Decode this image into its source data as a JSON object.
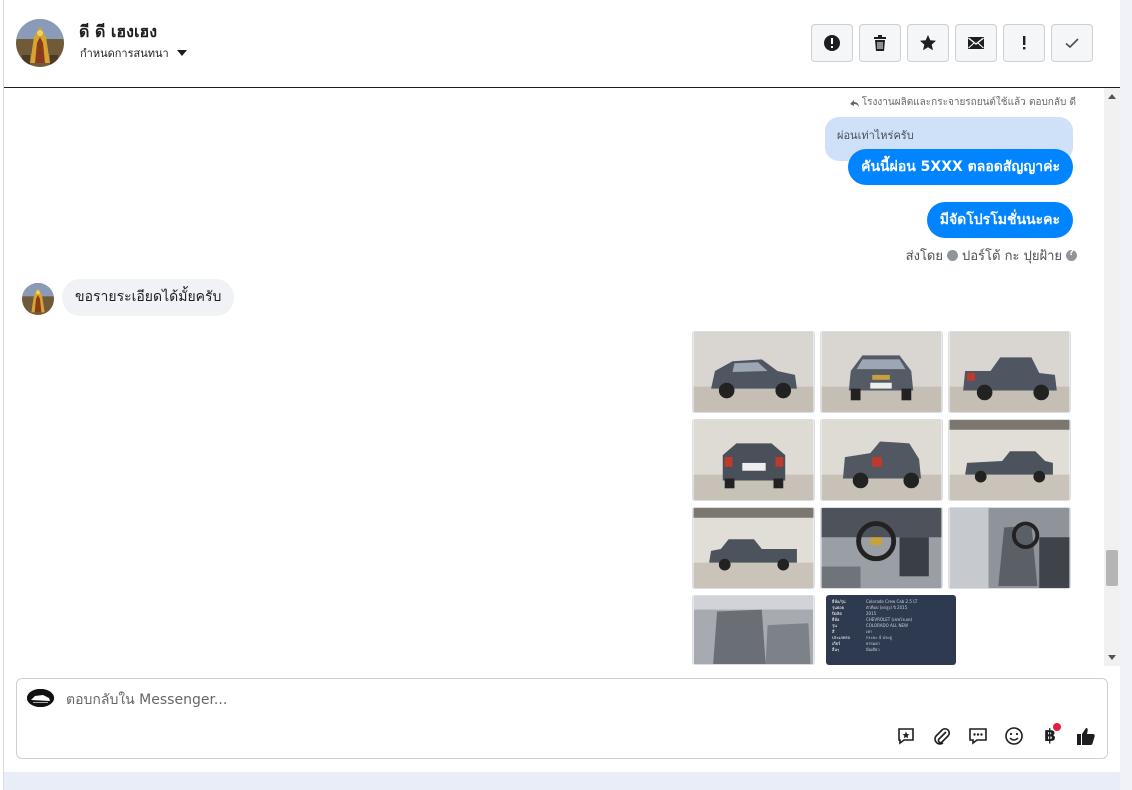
{
  "header": {
    "contact_name": "ดี ดี เฮงเฮง",
    "assign_label": "กำหนดการสนทนา",
    "actions": [
      {
        "name": "report-button",
        "icon": "alert-circle-icon"
      },
      {
        "name": "delete-button",
        "icon": "trash-icon"
      },
      {
        "name": "star-button",
        "icon": "star-icon"
      },
      {
        "name": "mark-unread-button",
        "icon": "envelope-icon"
      },
      {
        "name": "flag-button",
        "icon": "exclamation-icon"
      },
      {
        "name": "mark-done-button",
        "icon": "check-icon"
      }
    ]
  },
  "chat": {
    "reply_meta": "โรงงานผลิตและกระจายรถยนต์ใช้แล้ว ตอบกลับ ดี",
    "quoted_text": "ผ่อนเท่าไหร่ครับ",
    "outgoing": [
      "คันนี้ผ่อน 5XXX ตลอดสัญญาค่ะ",
      "มีจัดโปรโมชั่นนะคะ"
    ],
    "sent_by_prefix": "ส่งโดย",
    "sent_by_name": "ปอร์โต้ กะ ปุยฝ้าย",
    "incoming": "ขอรายระเอียดได้มั้ยครับ",
    "photos_count": 10,
    "doc_rows": [
      {
        "k": "ยี่ห้อ/รุ่น",
        "v": "Colorado Crew Cab 2.5 LT"
      },
      {
        "k": "รุ่นย่อย",
        "v": "ตัวท็อป (ยกสูง) ปี 2015"
      },
      {
        "k": "ปีผลิต",
        "v": "2015"
      },
      {
        "k": "ยี่ห้อ",
        "v": "CHEVROLET (เชฟโรเลต)"
      },
      {
        "k": "รุ่น",
        "v": "COLORADO ALL NEW"
      },
      {
        "k": "สี",
        "v": "เทา"
      },
      {
        "k": "ประเภทรถ",
        "v": "กระบะ 4 ประตู"
      },
      {
        "k": "เกียร์",
        "v": "ธรรมดา"
      },
      {
        "k": "อื่นๆ",
        "v": "มือเดียว"
      }
    ]
  },
  "composer": {
    "placeholder": "ตอบกลับใน Messenger...",
    "tools": [
      "saved-reply-icon",
      "attachment-icon",
      "message-template-icon",
      "emoji-icon",
      "payment-icon",
      "like-icon"
    ],
    "currency_symbol": "฿"
  },
  "colors": {
    "accent": "#0084ff",
    "quoted_bg": "#cfe1f9",
    "incoming_bg": "#f0f2f5"
  }
}
